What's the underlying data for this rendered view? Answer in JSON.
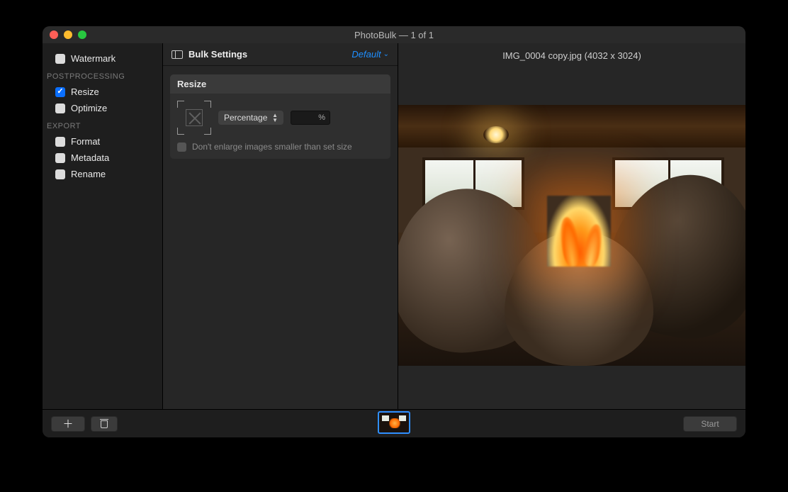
{
  "window": {
    "title": "PhotoBulk — 1 of 1"
  },
  "sidebar": {
    "watermark": {
      "label": "Watermark",
      "checked": false
    },
    "sections": {
      "postprocessing": {
        "label": "POSTPROCESSING"
      },
      "export": {
        "label": "EXPORT"
      }
    },
    "resize": {
      "label": "Resize",
      "checked": true
    },
    "optimize": {
      "label": "Optimize",
      "checked": false
    },
    "format": {
      "label": "Format",
      "checked": false
    },
    "metadata": {
      "label": "Metadata",
      "checked": false
    },
    "rename": {
      "label": "Rename",
      "checked": false
    }
  },
  "settings": {
    "header": "Bulk Settings",
    "preset": "Default",
    "panel_title": "Resize",
    "mode": "Percentage",
    "unit": "%",
    "percent_value": "",
    "dont_enlarge": {
      "label": "Don't enlarge images smaller than set size",
      "checked": false
    }
  },
  "preview": {
    "filename_line": "IMG_0004 copy.jpg (4032 x 3024)"
  },
  "footer": {
    "start": "Start"
  }
}
